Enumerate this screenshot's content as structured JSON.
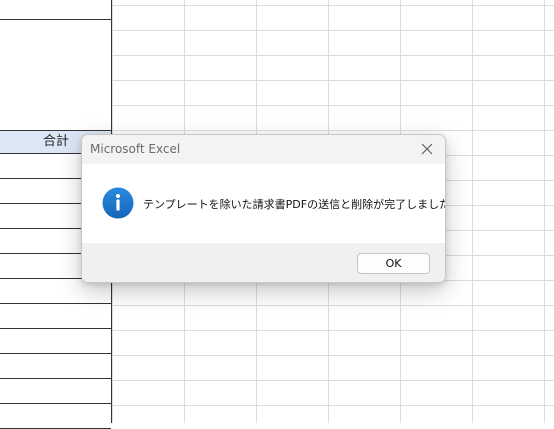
{
  "sheet": {
    "header_label": "合計"
  },
  "dialog": {
    "title": "Microsoft Excel",
    "message": "テンプレートを除いた請求書PDFの送信と削除が完了しました！",
    "ok_label": "OK",
    "icon": "info-icon",
    "close_icon": "close-icon"
  },
  "colors": {
    "header_fill": "#dce7f5",
    "info_icon": "#1a74c8"
  }
}
